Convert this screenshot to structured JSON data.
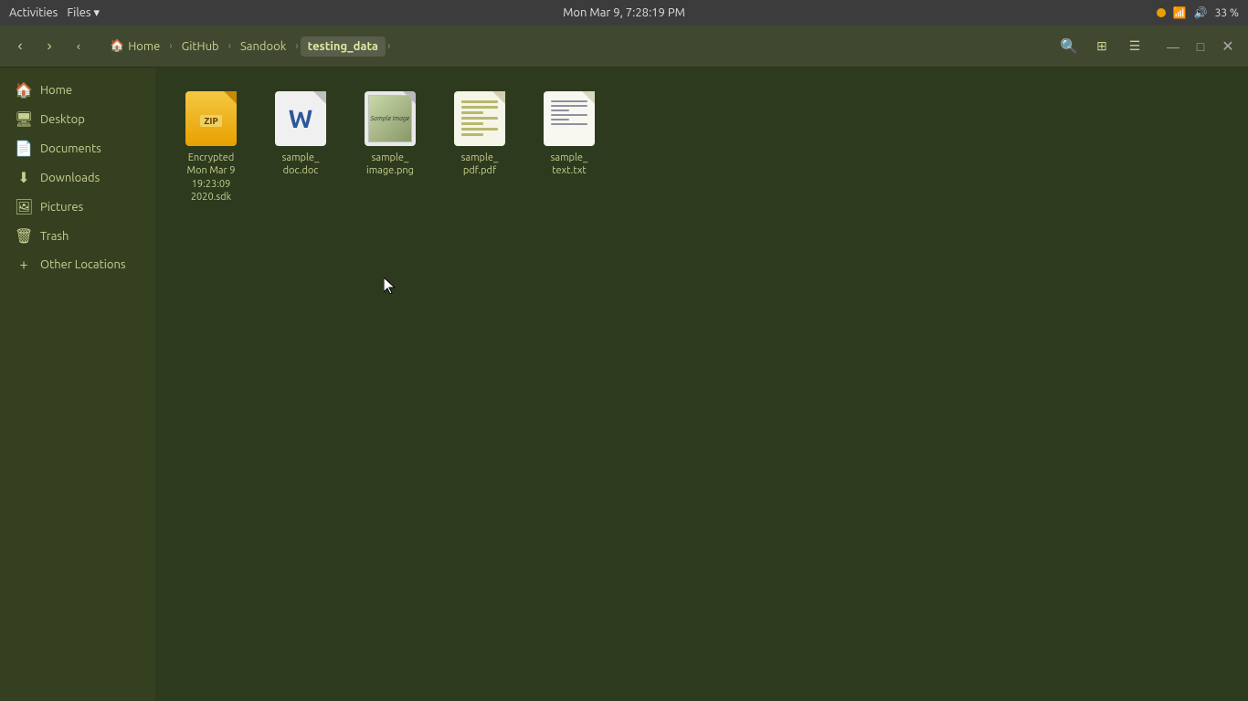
{
  "topbar": {
    "activities": "Activities",
    "files_menu": "Files ▾",
    "datetime": "Mon Mar 9,  7:28:19 PM",
    "battery_pct": "33 %"
  },
  "toolbar": {
    "back_label": "‹",
    "forward_label": "›",
    "up_label": "‹",
    "breadcrumbs": [
      {
        "id": "home",
        "label": "Home",
        "icon": "🏠",
        "active": false
      },
      {
        "id": "github",
        "label": "GitHub",
        "active": false
      },
      {
        "id": "sandook",
        "label": "Sandook",
        "active": false
      },
      {
        "id": "testing_data",
        "label": "testing_data",
        "active": true
      }
    ],
    "search_icon": "🔍",
    "view_list_icon": "≡",
    "view_grid_icon": "⊞",
    "minimize_label": "—",
    "maximize_label": "□",
    "close_label": "✕"
  },
  "sidebar": {
    "items": [
      {
        "id": "home",
        "label": "Home",
        "icon": "🏠"
      },
      {
        "id": "desktop",
        "label": "Desktop",
        "icon": "🖥"
      },
      {
        "id": "documents",
        "label": "Documents",
        "icon": "📄"
      },
      {
        "id": "downloads",
        "label": "Downloads",
        "icon": "⬇"
      },
      {
        "id": "pictures",
        "label": "Pictures",
        "icon": "🖼"
      },
      {
        "id": "trash",
        "label": "Trash",
        "icon": "🗑"
      },
      {
        "id": "other-locations",
        "label": "Other Locations",
        "icon": "+"
      }
    ]
  },
  "files": [
    {
      "id": "encrypted-sdk",
      "type": "zip",
      "label": "Encrypted\nMon Mar 9\n19:23:09\n2020.sdk"
    },
    {
      "id": "sample-doc",
      "type": "doc",
      "label": "sample_\ndoc.doc"
    },
    {
      "id": "sample-image",
      "type": "png",
      "label": "sample_\nimage.png"
    },
    {
      "id": "sample-pdf",
      "type": "pdf",
      "label": "sample_\npdf.pdf"
    },
    {
      "id": "sample-text",
      "type": "txt",
      "label": "sample_\ntext.txt"
    }
  ]
}
